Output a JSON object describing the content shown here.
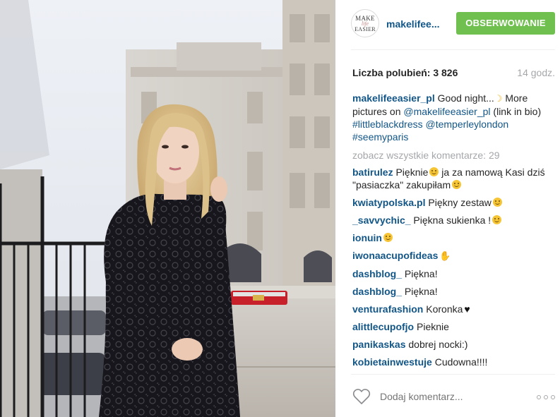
{
  "post": {
    "username": "makelifee...",
    "avatar_text": {
      "line1": "MAKE",
      "line2": "life",
      "line3": "EASIER"
    },
    "follow_label": "OBSERWOWANIE",
    "likes_text": "Liczba polubień: 3 826",
    "time_text": "14 godz."
  },
  "caption": {
    "user": "makelifeeasier_pl",
    "text1": "Good night...",
    "text2": "More pictures on",
    "mention": "@makelifeeasier_pl",
    "text3": "(link in bio)",
    "tag1": "#littleblackdress",
    "mention2": "@temperleylondon",
    "tag2": "#seemyparis"
  },
  "view_all": "zobacz wszystkie komentarze: 29",
  "comments": [
    {
      "user": "batirulez",
      "text": "Pięknie",
      "text2": "ja za namową Kasi dziś \"pasiaczka\" zakupiłam",
      "emoji": "smile"
    },
    {
      "user": "kwiatypolska.pl",
      "text": "Piękny zestaw",
      "emoji": "smile"
    },
    {
      "user": "_savvychic_",
      "text": "Piękna sukienka !",
      "emoji": "smile"
    },
    {
      "user": "ionuin",
      "text": "",
      "emoji": "smile"
    },
    {
      "user": "iwonaacupofideas",
      "text": "",
      "emoji": "hand"
    },
    {
      "user": "dashblog_",
      "text": "Piękna!"
    },
    {
      "user": "dashblog_",
      "text": "Piękna!"
    },
    {
      "user": "venturafashion",
      "text": "Koronka",
      "emoji": "heart"
    },
    {
      "user": "alittlecupofjo",
      "text": "Pieknie"
    },
    {
      "user": "panikaskas",
      "text": "dobrej nocki:)"
    },
    {
      "user": "kobietainwestuje",
      "text": "Cudowna!!!!"
    }
  ],
  "footer": {
    "comment_placeholder": "Dodaj komentarz...",
    "icons": {
      "like": "heart-outline-icon",
      "more": "more-options-icon"
    }
  },
  "colors": {
    "accent": "#125688",
    "follow_bg": "#70c050",
    "muted": "#a5a7aa"
  }
}
